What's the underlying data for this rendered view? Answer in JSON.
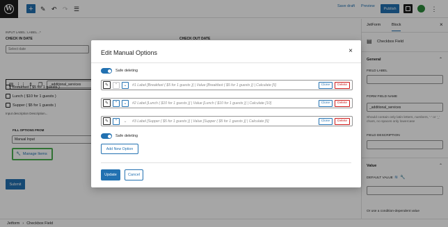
{
  "toolbar": {
    "save_draft": "Save draft",
    "preview": "Preview",
    "publish": "Publish"
  },
  "editor": {
    "input_label_hint": "INPUT LABEL: LABEL...*",
    "check_in_label": "CHECK IN DATE",
    "check_out_label": "CHECK OUT DATE",
    "date_placeholder": "Select date",
    "field_name_value": "_additional_services",
    "options": [
      "Breakfast ( $5 for 1 guests )",
      "Lunch ( $10 for 1 guests )",
      "Supper ( $5 for 1 guests )"
    ],
    "input_description": "Input description   Description...",
    "fill_options_label": "FILL OPTIONS FROM",
    "fill_options_value": "Manual Input",
    "manage_items": "Manage Items",
    "submit": "Submit"
  },
  "sidebar": {
    "tab_jetform": "JetForm",
    "tab_block": "Block",
    "block_name": "Checkbox Field",
    "general": "General",
    "field_label": "FIELD LABEL",
    "form_field_name": "FORM FIELD NAME",
    "form_field_name_value": "_additional_services",
    "field_name_help": "Should contain only latin letters, numbers, '-' or '_' chars, no spaces only lowercase",
    "field_description": "FIELD DESCRIPTION",
    "value_section": "Value",
    "default_value": "DEFAULT VALUE",
    "condition_hint": "Or use a condition-dependent value"
  },
  "footer": {
    "crumbs": [
      "Jetform",
      "›",
      "Checkbox Field"
    ]
  },
  "modal": {
    "title": "Edit Manual Options",
    "close": "×",
    "safe_deleting": "Safe deleting",
    "rows": [
      {
        "text": "#1 Label [Breakfast ( $5 for 1 guests )] | Value [Breakfast ( $5 for 1 guests )] | Calculate [5]",
        "clone": "Clone",
        "delete": "Delete"
      },
      {
        "text": "#2 Label [Lunch ( $10 for 1 guests )] | Value [Lunch ( $10 for 1 guests )] | Calculate [10]",
        "clone": "Clone",
        "delete": "Delete"
      },
      {
        "text": "#3 Label [Supper ( $5 for 1 guests )] | Value [Supper ( $5 for 1 guests )] | Calculate [5]",
        "clone": "Clone",
        "delete": "Delete"
      }
    ],
    "add_new_option": "Add New Option",
    "update": "Update",
    "cancel": "Cancel"
  },
  "colors": {
    "accent": "#2271b1",
    "danger": "#cc1818",
    "highlight": "#4caf50"
  }
}
